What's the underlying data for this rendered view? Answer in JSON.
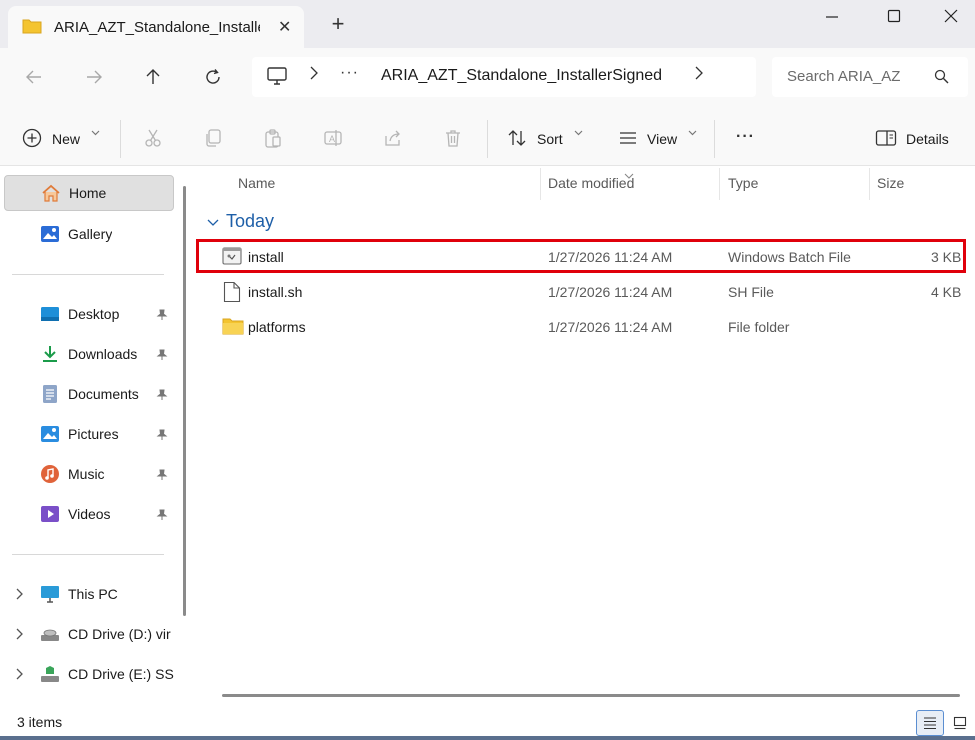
{
  "window": {
    "tab_title": "ARIA_AZT_Standalone_Installe",
    "new_tab": "+",
    "close_tab": "✕"
  },
  "address": {
    "ellipsis": "···",
    "path": "ARIA_AZT_Standalone_InstallerSigned",
    "search_placeholder": "Search ARIA_AZ"
  },
  "toolbar": {
    "new_label": "New",
    "sort_label": "Sort",
    "view_label": "View",
    "more_label": "···",
    "details_label": "Details"
  },
  "sidebar": {
    "home": "Home",
    "gallery": "Gallery",
    "pinned": [
      {
        "label": "Desktop",
        "icon": "desktop-icon"
      },
      {
        "label": "Downloads",
        "icon": "downloads-icon"
      },
      {
        "label": "Documents",
        "icon": "documents-icon"
      },
      {
        "label": "Pictures",
        "icon": "pictures-icon"
      },
      {
        "label": "Music",
        "icon": "music-icon"
      },
      {
        "label": "Videos",
        "icon": "videos-icon"
      }
    ],
    "drives": [
      {
        "label": "This PC"
      },
      {
        "label": "CD Drive (D:) vir"
      },
      {
        "label": "CD Drive (E:) SSS"
      }
    ]
  },
  "columns": {
    "name": "Name",
    "date": "Date modified",
    "type": "Type",
    "size": "Size"
  },
  "group": "Today",
  "files": [
    {
      "name": "install",
      "date": "1/27/2026 11:24 AM",
      "type": "Windows Batch File",
      "size": "3 KB",
      "icon": "batch-file-icon",
      "highlighted": true
    },
    {
      "name": "install.sh",
      "date": "1/27/2026 11:24 AM",
      "type": "SH File",
      "size": "4 KB",
      "icon": "file-icon",
      "highlighted": false
    },
    {
      "name": "platforms",
      "date": "1/27/2026 11:24 AM",
      "type": "File folder",
      "size": "",
      "icon": "folder-icon",
      "highlighted": false
    }
  ],
  "status": {
    "item_count": "3 items"
  },
  "colors": {
    "highlight_border": "#e0000b",
    "group_heading": "#1e5fa8",
    "folder_yellow": "#f4c430"
  }
}
